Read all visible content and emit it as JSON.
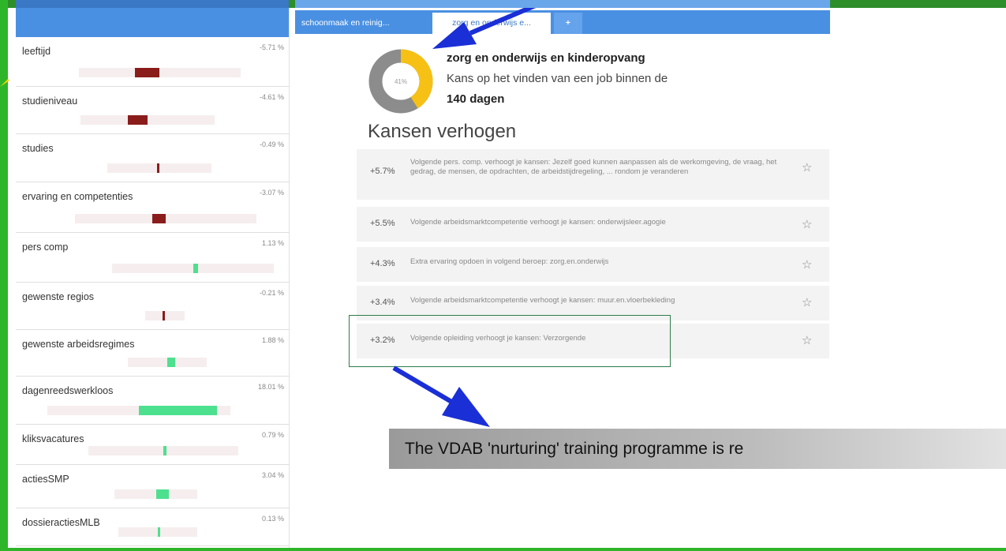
{
  "tabs": [
    {
      "label": "schoonmaak en reinig..."
    },
    {
      "label": "zorg en onderwijs e..."
    },
    {
      "label": "+"
    }
  ],
  "job": {
    "title": "zorg en onderwijs en kinderopvang",
    "line": "Kans op het vinden van een job binnen de",
    "days": "140 dagen",
    "chance_label": "41%",
    "chance_value": 0.41
  },
  "section_title": "Kansen verhogen",
  "tips": [
    {
      "pct": "+5.7%",
      "text": "Volgende pers. comp. verhoogt je kansen: Jezelf goed kunnen aanpassen als de werkomgeving, de vraag, het gedrag, de mensen, de opdrachten, de arbeidstijdregeling, ... rondom je veranderen",
      "star": "☆"
    },
    {
      "pct": "+5.5%",
      "text": "Volgende arbeidsmarktcompetentie verhoogt je kansen: onderwijsleer.agogie",
      "star": "☆"
    },
    {
      "pct": "+4.3%",
      "text": "Extra ervaring opdoen in volgend beroep: zorg.en.onderwijs",
      "star": "☆"
    },
    {
      "pct": "+3.4%",
      "text": "Volgende arbeidsmarktcompetentie verhoogt je kansen: muur.en.vloerbekleding",
      "star": "☆"
    },
    {
      "pct": "+3.2%",
      "text": "Volgende opleiding verhoogt je kansen: Verzorgende",
      "star": "☆"
    }
  ],
  "factors": [
    {
      "name": "leeftijd",
      "pct": "-5.71 %",
      "value": -5.71
    },
    {
      "name": "studieniveau",
      "pct": "-4.61 %",
      "value": -4.61
    },
    {
      "name": "studies",
      "pct": "-0.49 %",
      "value": -0.49
    },
    {
      "name": "ervaring en competenties",
      "pct": "-3.07 %",
      "value": -3.07
    },
    {
      "name": "pers comp",
      "pct": "1.13 %",
      "value": 1.13
    },
    {
      "name": "gewenste regios",
      "pct": "-0.21 %",
      "value": -0.21
    },
    {
      "name": "gewenste arbeidsregimes",
      "pct": "1.88 %",
      "value": 1.88
    },
    {
      "name": "dagenreedswerkloos",
      "pct": "18.01 %",
      "value": 18.01
    },
    {
      "name": "kliksvacatures",
      "pct": "0.79 %",
      "value": 0.79
    },
    {
      "name": "actiesSMP",
      "pct": "3.04 %",
      "value": 3.04
    },
    {
      "name": "dossieractiesMLB",
      "pct": "0.13 %",
      "value": 0.13
    }
  ],
  "caption": "The VDAB 'nurturing' training programme is re",
  "colors": {
    "accent": "#4a90e2",
    "negative": "#8b1c1c",
    "positive": "#4de08f",
    "donut_yellow": "#f6c114",
    "donut_gray": "#8c8c8c",
    "frame_green": "#2fb52a",
    "arrow_blue": "#1a2fd6"
  },
  "icons": {
    "star": "star-icon",
    "arrow": "arrow-annotation"
  }
}
